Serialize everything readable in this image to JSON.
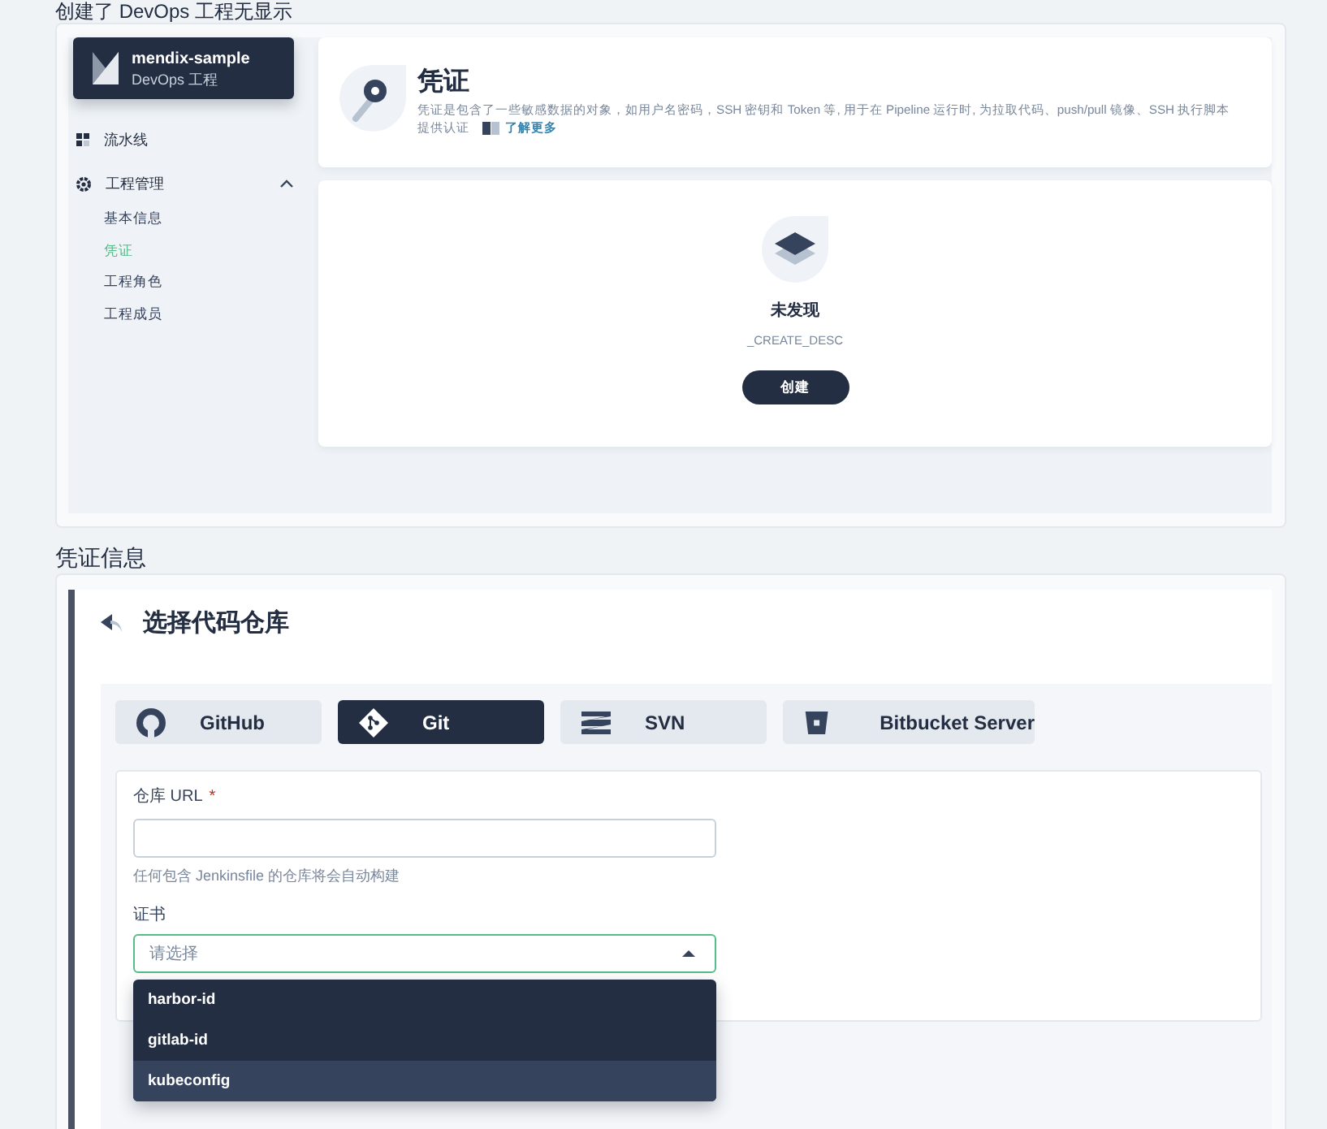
{
  "top_caption": "创建了 DevOps 工程无显示",
  "project": {
    "name": "mendix-sample",
    "subtitle": "DevOps 工程"
  },
  "sidebar": {
    "items": [
      {
        "label": "流水线",
        "kind": "pipeline"
      },
      {
        "label": "工程管理",
        "kind": "settings",
        "expanded": true,
        "children": [
          {
            "label": "基本信息",
            "selected": false
          },
          {
            "label": "凭证",
            "selected": true
          },
          {
            "label": "工程角色",
            "selected": false
          },
          {
            "label": "工程成员",
            "selected": false
          }
        ]
      }
    ]
  },
  "header": {
    "title": "凭证",
    "description": "凭证是包含了一些敏感数据的对象，如用户名密码，SSH 密钥和 Token 等, 用于在 Pipeline 运行时, 为拉取代码、push/pull 镜像、SSH 执行脚本",
    "description_continued": "提供认证",
    "link": "了解更多"
  },
  "empty_state": {
    "title": "未发现",
    "description": "_CREATE_DESC",
    "button": "创建"
  },
  "section_caption": "凭证信息",
  "repo_panel": {
    "title": "选择代码仓库",
    "tabs": [
      {
        "label": "GitHub",
        "kind": "github",
        "selected": false
      },
      {
        "label": "Git",
        "kind": "git",
        "selected": true
      },
      {
        "label": "SVN",
        "kind": "svn",
        "selected": false
      },
      {
        "label": "Bitbucket Server",
        "kind": "bitbucket",
        "selected": false
      }
    ],
    "url_field": {
      "label": "仓库 URL",
      "required_mark": "*",
      "hint": "任何包含 Jenkinsfile 的仓库将会自动构建"
    },
    "cert_field": {
      "label": "证书",
      "placeholder": "请选择",
      "open": true,
      "options": [
        {
          "label": "harbor-id",
          "highlighted": false
        },
        {
          "label": "gitlab-id",
          "highlighted": false
        },
        {
          "label": "kubeconfig",
          "highlighted": true
        }
      ]
    }
  }
}
